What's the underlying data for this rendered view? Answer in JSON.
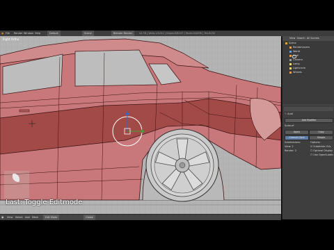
{
  "topbar": {
    "menu": [
      "File",
      "Render",
      "Window",
      "Help"
    ],
    "screen_layout": "Default",
    "scene": "Scene",
    "render_engine": "Blender Render",
    "version_info": "v2.78 | Verts:1/4152 | Edges:0/8247 | Faces:0/4096 | Tris:8192"
  },
  "viewport": {
    "view_label": "Right Ortho",
    "header_items": [
      "View",
      "Select",
      "Add",
      "Mesh",
      "Edit Mode",
      "Global"
    ]
  },
  "last_operator": "Last: Toggle Editmode",
  "outliner": {
    "tabs": [
      "View",
      "Search",
      "All Scenes"
    ],
    "items": [
      "Scene",
      "RenderLayers",
      "World",
      "Audi",
      "Camera",
      "Lamp",
      "Lightcircle",
      "Wheels"
    ]
  },
  "properties": {
    "header": "Audi",
    "panel_title": "Add Modifier",
    "modifier_name": "Subsurf",
    "buttons": [
      "Apply",
      "Copy"
    ],
    "tabs": [
      "Catmull-Clark",
      "Simple"
    ],
    "subdivisions_label": "Subdivisions:",
    "view_label": "View:",
    "view_value": "2",
    "render_label": "Render:",
    "render_value": "2",
    "options_label": "Options:",
    "options": [
      "Subdivide UVs",
      "Optimal Display",
      "Use OpenSubdiv"
    ]
  },
  "colors": {
    "car_body": "#c8787a",
    "car_body_dark": "#a24a48",
    "grid_bg": "#b4b4b4",
    "panel_bg": "#3e3e3e",
    "wire": "#2a0a0a"
  }
}
